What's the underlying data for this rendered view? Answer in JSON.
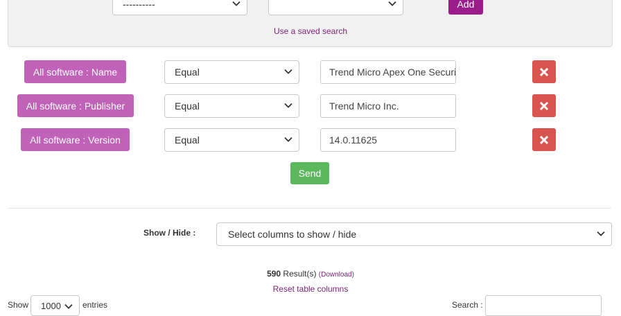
{
  "saved_search": {
    "select1_value": "----------",
    "select2_value": "",
    "add_label": "Add",
    "link_text": "Use a saved search"
  },
  "criteria": [
    {
      "field_label": "All software : Name",
      "operator": "Equal",
      "value": "Trend Micro Apex One Security Agent"
    },
    {
      "field_label": "All software : Publisher",
      "operator": "Equal",
      "value": "Trend Micro Inc."
    },
    {
      "field_label": "All software : Version",
      "operator": "Equal",
      "value": "14.0.11625"
    }
  ],
  "send_label": "Send",
  "columns": {
    "label": "Show / Hide :",
    "select_text": "Select columns to show / hide"
  },
  "results": {
    "count": "590",
    "text": " Result(s) ",
    "download": "(Download)",
    "reset_link": "Reset table columns"
  },
  "table_controls": {
    "show_label": "Show",
    "entries_value": "1000",
    "entries_label": "entries",
    "search_label": "Search :"
  },
  "colors": {
    "add_button": "#9b1d8c",
    "criteria_label": "#c062b8",
    "remove_button": "#d9534f",
    "send_button": "#5cb85c",
    "link": "#7a2577"
  },
  "icons": {
    "remove": "close-icon",
    "dropdown": "chevron-down-icon"
  }
}
